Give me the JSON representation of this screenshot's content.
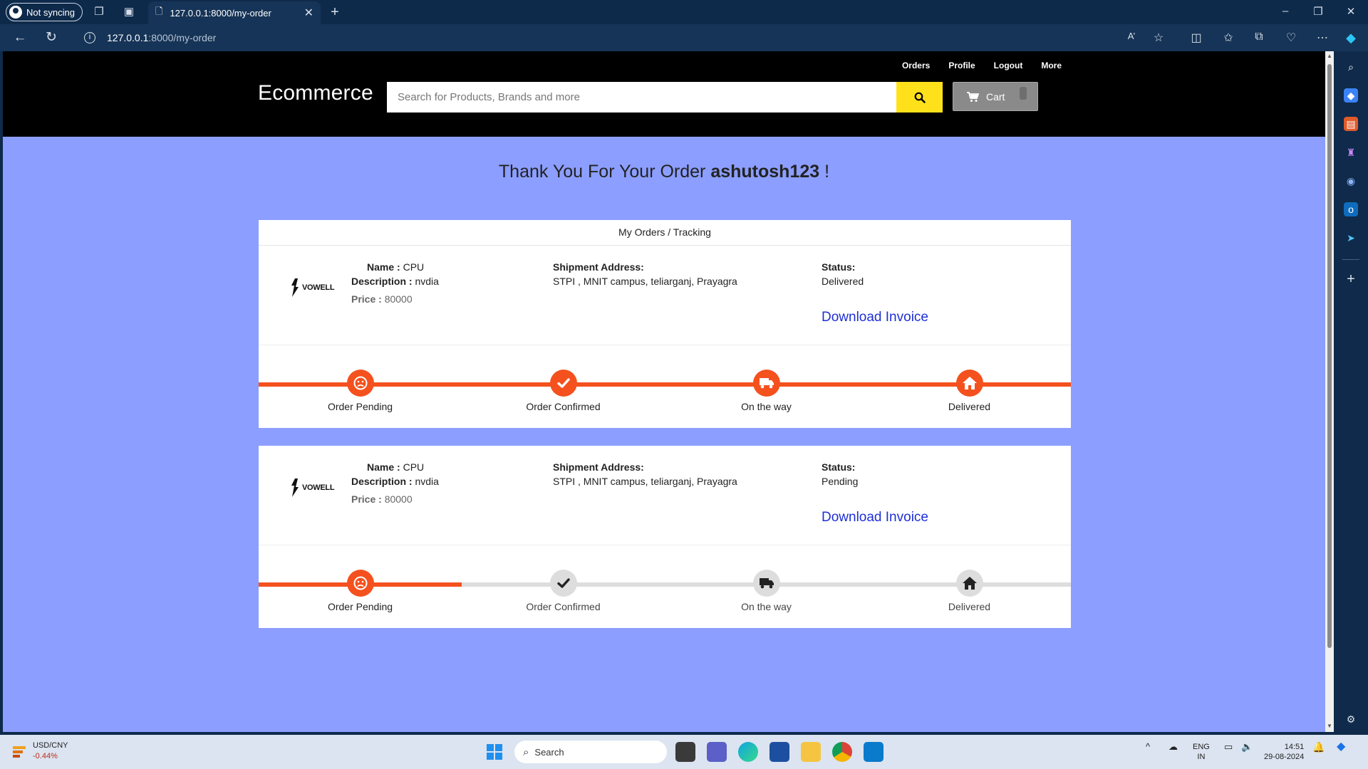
{
  "browser": {
    "profile_label": "Not syncing",
    "tab_title": "127.0.0.1:8000/my-order",
    "url_host": "127.0.0.1",
    "url_path": ":8000/my-order"
  },
  "header": {
    "brand": "Ecommerce",
    "nav_links": [
      "Orders",
      "Profile",
      "Logout",
      "More"
    ],
    "search_placeholder": "Search for Products, Brands and more",
    "cart_label": "Cart"
  },
  "thank_you": {
    "prefix": "Thank You For Your Order",
    "username": "ashutosh123",
    "suffix": "!"
  },
  "orders_title": "My Orders / Tracking",
  "labels": {
    "name": "Name :",
    "description": "Description :",
    "price": "Price :",
    "shipment": "Shipment Address:",
    "status": "Status:",
    "invoice": "Download Invoice",
    "logo_text": "VOWELL"
  },
  "steps": [
    "Order Pending",
    "Order Confirmed",
    "On the way",
    "Delivered"
  ],
  "orders": [
    {
      "name": "CPU",
      "description": "nvdia",
      "price": "80000",
      "address": "STPI , MNIT campus, teliarganj, Prayagra",
      "status": "Delivered",
      "progress_steps": 4
    },
    {
      "name": "CPU",
      "description": "nvdia",
      "price": "80000",
      "address": "STPI , MNIT campus, teliarganj, Prayagra",
      "status": "Pending",
      "progress_steps": 1
    }
  ],
  "taskbar": {
    "ticker": "USD/CNY",
    "change": "-0.44%",
    "search_label": "Search",
    "lang_top": "ENG",
    "lang_bottom": "IN",
    "time": "14:51",
    "date": "29-08-2024"
  },
  "colors": {
    "accent": "#f4511e",
    "page_bg": "#8c9eff",
    "search_button": "#ffe11b",
    "link": "#1e2fd6"
  }
}
